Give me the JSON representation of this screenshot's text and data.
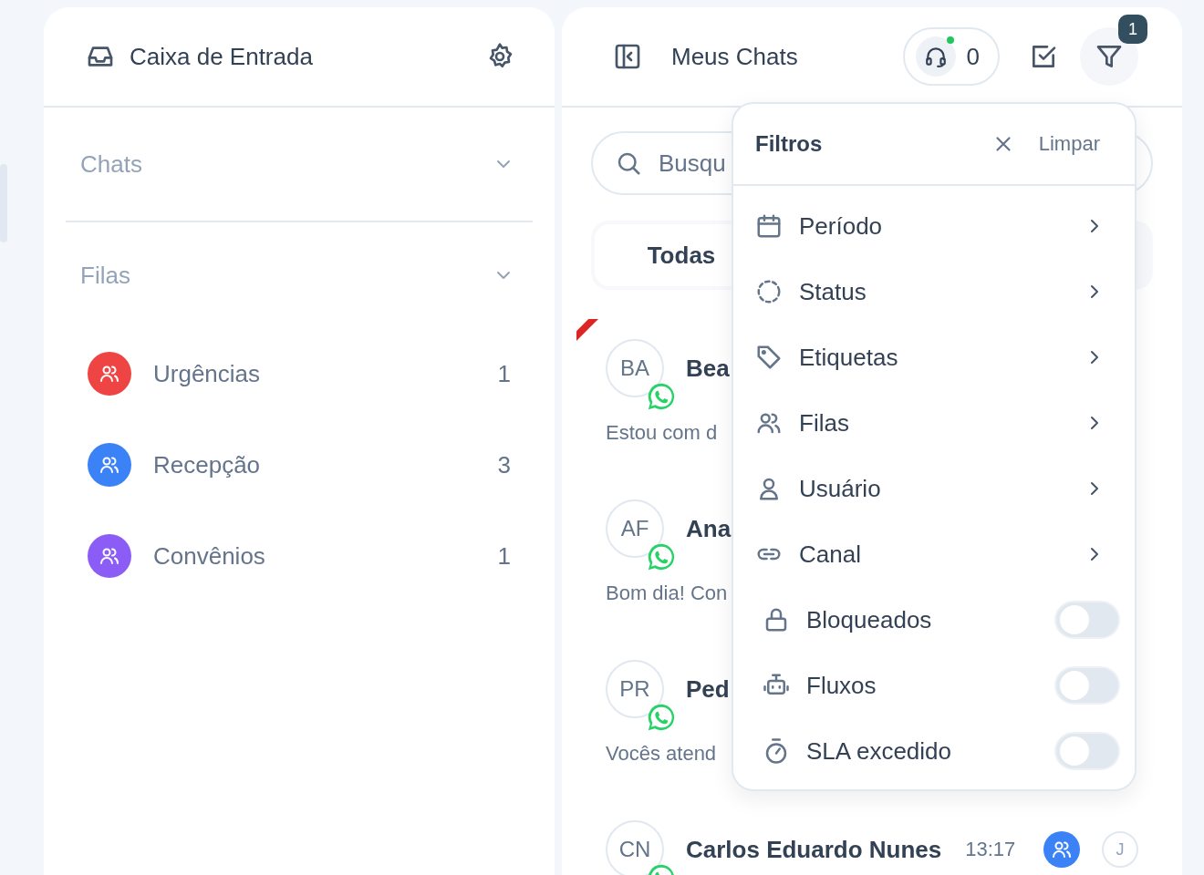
{
  "inbox": {
    "title": "Caixa de Entrada",
    "sections": [
      {
        "label": "Chats"
      },
      {
        "label": "Filas",
        "queues": [
          {
            "name": "Urgências",
            "count": "1",
            "color": "#ef4444"
          },
          {
            "name": "Recepção",
            "count": "3",
            "color": "#3b82f6"
          },
          {
            "name": "Convênios",
            "count": "1",
            "color": "#8b5cf6"
          }
        ]
      }
    ]
  },
  "chats_panel": {
    "title": "Meus Chats",
    "online_count": "0",
    "filter_badge": "1",
    "search": {
      "placeholder": "Busqu"
    },
    "tabs": [
      {
        "label": "Todas",
        "selected": true
      }
    ],
    "chats": [
      {
        "initials": "BA",
        "name": "Bea",
        "preview": "Estou com d",
        "flagged": true
      },
      {
        "initials": "AF",
        "name": "Ana",
        "preview": "Bom dia! Con",
        "flagged": false
      },
      {
        "initials": "PR",
        "name": "Ped",
        "preview": "Vocês atend",
        "flagged": false
      },
      {
        "initials": "CN",
        "name": "Carlos Eduardo Nunes",
        "time": "13:17",
        "color": "#3b82f6",
        "agent": "J",
        "flagged": false
      }
    ]
  },
  "filters": {
    "title": "Filtros",
    "clear": "Limpar",
    "items": [
      {
        "kind": "submenu",
        "label": "Período"
      },
      {
        "kind": "submenu",
        "label": "Status"
      },
      {
        "kind": "submenu",
        "label": "Etiquetas"
      },
      {
        "kind": "submenu",
        "label": "Filas"
      },
      {
        "kind": "submenu",
        "label": "Usuário"
      },
      {
        "kind": "submenu",
        "label": "Canal"
      },
      {
        "kind": "toggle",
        "label": "Bloqueados",
        "on": false
      },
      {
        "kind": "toggle",
        "label": "Fluxos",
        "on": false
      },
      {
        "kind": "toggle",
        "label": "SLA excedido",
        "on": false
      }
    ]
  }
}
